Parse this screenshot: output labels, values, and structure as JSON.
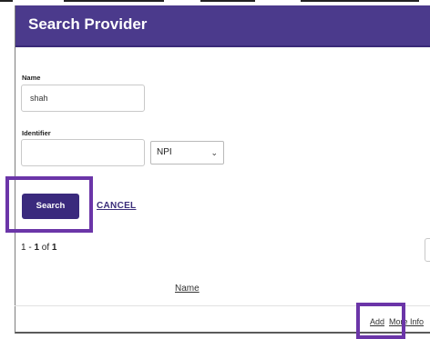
{
  "header": {
    "title": "Search Provider"
  },
  "form": {
    "name_label": "Name",
    "name_value": "shah",
    "identifier_label": "Identifier",
    "identifier_value": "",
    "identifier_type_selected": "NPI"
  },
  "actions": {
    "search_label": "Search",
    "cancel_label": "CANCEL"
  },
  "results": {
    "range_start": "1",
    "range_sep": " - ",
    "range_end": "1",
    "of_text": " of ",
    "total": "1",
    "column_name": "Name",
    "row_add": "Add",
    "row_more_info": "More Info"
  },
  "colors": {
    "header": "#4b3a8c",
    "button": "#3a2a7d",
    "highlight": "#6b35a8"
  }
}
